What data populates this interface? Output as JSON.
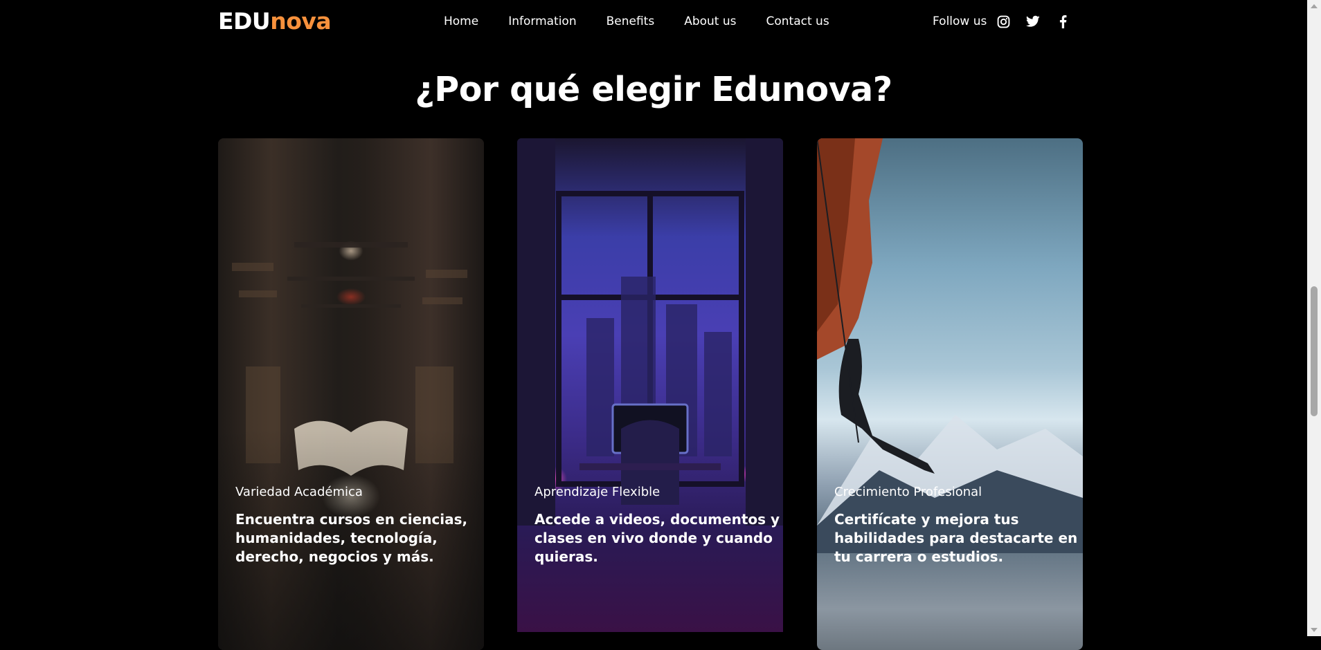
{
  "brand": {
    "part1": "EDU",
    "part2": "nova",
    "accent": "#f7913c"
  },
  "nav": [
    "Home",
    "Information",
    "Benefits",
    "About us",
    "Contact us"
  ],
  "follow_label": "Follow us",
  "social_icons": [
    "instagram-icon",
    "twitter-icon",
    "facebook-icon"
  ],
  "section_title": "¿Por qué elegir Edunova?",
  "cards": [
    {
      "caption": "Variedad Académica",
      "description": "Encuentra cursos en ciencias, humanidades, tecnología, derecho, negocios y más."
    },
    {
      "caption": "Aprendizaje Flexible",
      "description": "Accede a videos, documentos y clases en vivo donde y cuando quieras."
    },
    {
      "caption": "Crecimiento Profesional",
      "description": "Certifícate y mejora tus habilidades para destacarte en tu carrera o estudios."
    }
  ]
}
